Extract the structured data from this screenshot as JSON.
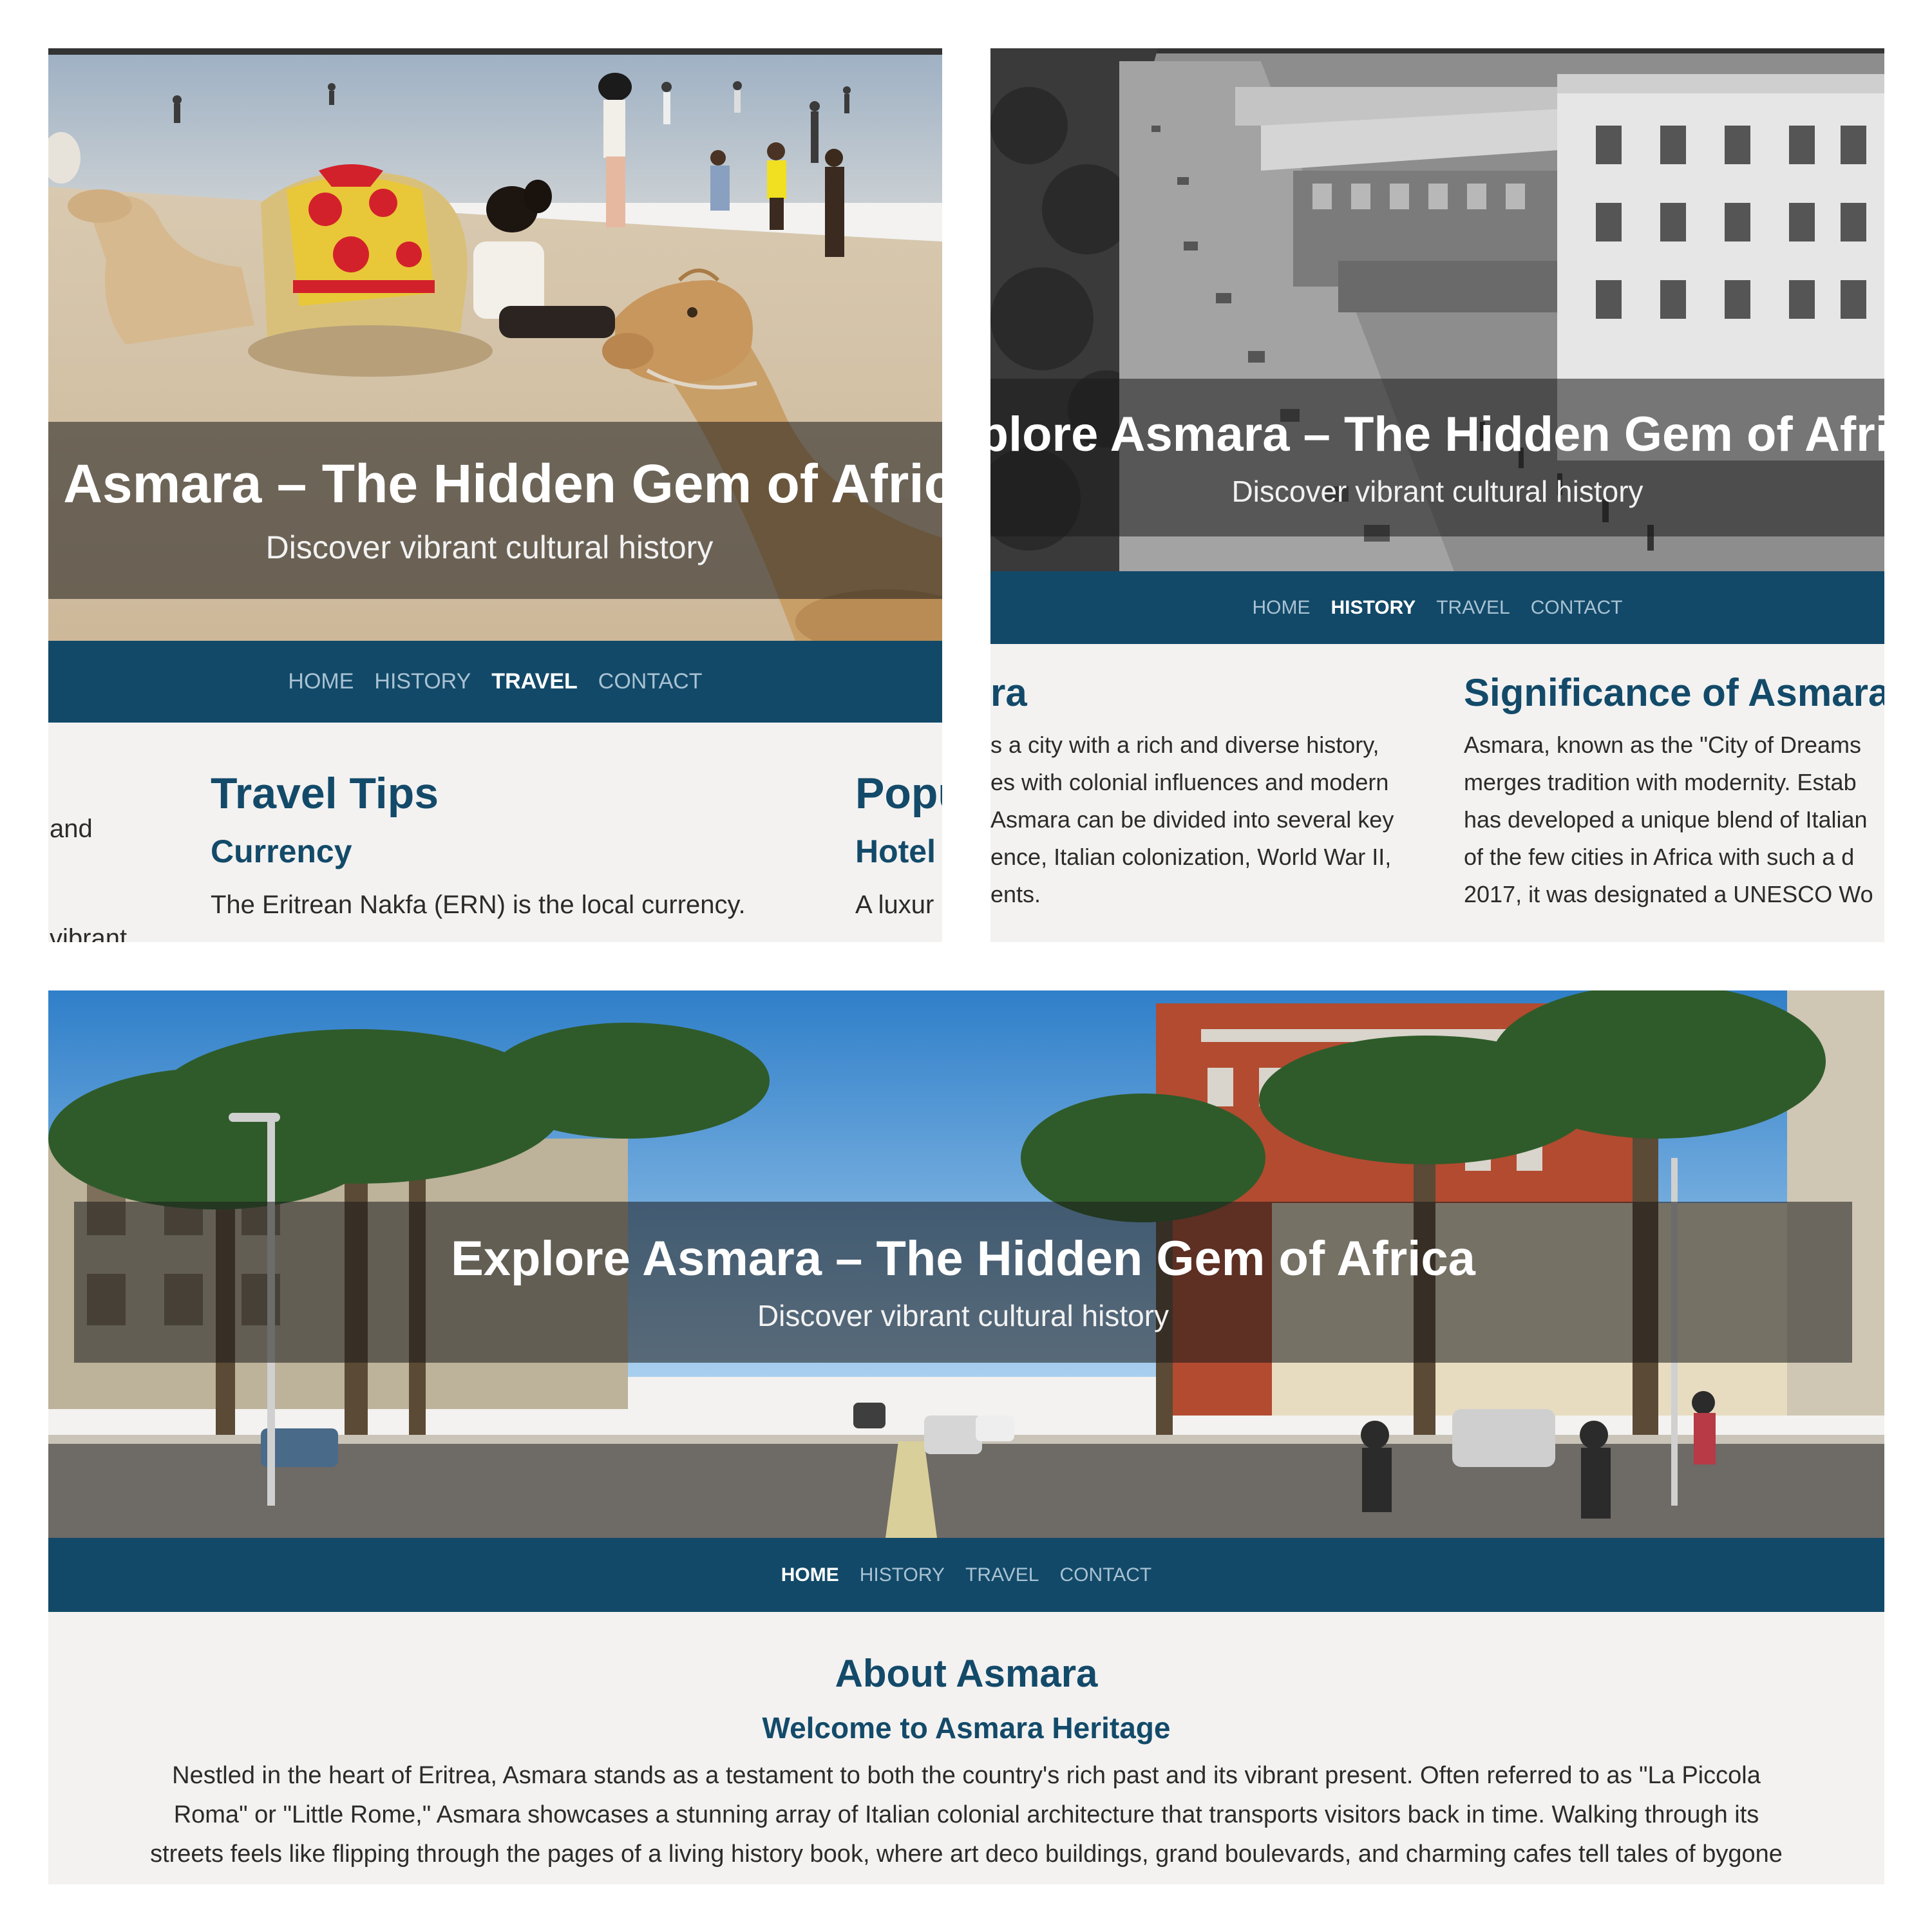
{
  "site": {
    "hero_title": "Explore Asmara – The Hidden Gem of Africa",
    "hero_subtitle": "Discover vibrant cultural history",
    "nav": [
      "HOME",
      "HISTORY",
      "TRAVEL",
      "CONTACT"
    ]
  },
  "colors": {
    "nav_bg": "#124968",
    "heading": "#134a69",
    "content_bg": "#f3f2f1"
  },
  "travel_page": {
    "active_nav": "TRAVEL",
    "left_fragment_lines": [
      "and",
      "vibrant"
    ],
    "travel_tips": {
      "heading": "Travel Tips",
      "subheading": "Currency",
      "text": "The Eritrean Nakfa (ERN) is the local currency."
    },
    "popular": {
      "heading_fragment": "Popu",
      "subheading_fragment": "Hotel",
      "text_fragment": "A luxur"
    }
  },
  "history_page": {
    "active_nav": "HISTORY",
    "left_column": {
      "heading_fragment": "ra",
      "lines": [
        "s a city with a rich and diverse history,",
        "es with colonial influences and modern",
        "Asmara can be divided into several key",
        "ence, Italian colonization, World War II,",
        "ents."
      ]
    },
    "significance": {
      "heading": "Significance of Asmara",
      "lines": [
        "Asmara, known as the \"City of Dreams",
        "merges tradition with modernity. Estab",
        "has developed a unique blend of Italian",
        "of the few cities in Africa with such a d",
        "2017, it was designated a UNESCO Wo"
      ]
    }
  },
  "home_page": {
    "active_nav": "HOME",
    "about_heading": "About Asmara",
    "welcome_heading": "Welcome to Asmara Heritage",
    "lines": [
      "Nestled in the heart of Eritrea, Asmara stands as a testament to both the country's rich past and its vibrant present. Often referred to as \"La Piccola",
      "Roma\" or \"Little Rome,\" Asmara showcases a stunning array of Italian colonial architecture that transports visitors back in time. Walking through its",
      "streets feels like flipping through the pages of a living history book, where art deco buildings, grand boulevards, and charming cafes tell tales of bygone"
    ]
  }
}
